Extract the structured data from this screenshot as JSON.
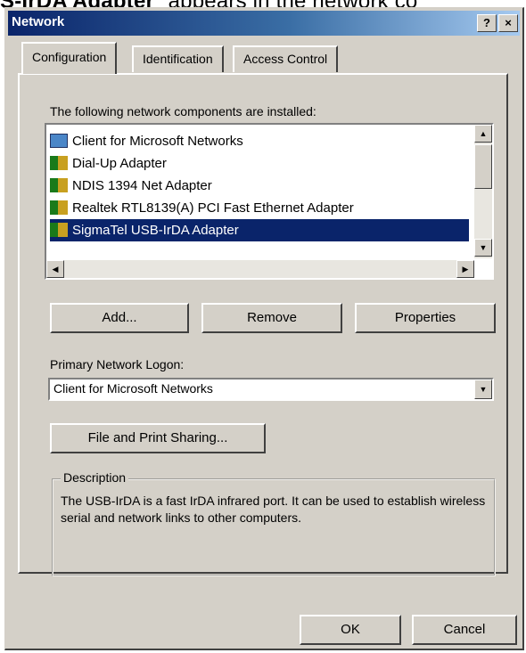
{
  "caption_top": {
    "bold": "S-IrDA Adapter",
    "rest": "\" appears in the network co"
  },
  "window": {
    "title": "Network",
    "help_btn": "?",
    "close_btn": "×"
  },
  "tabs": [
    "Configuration",
    "Identification",
    "Access Control"
  ],
  "components_label": "The following network components are installed:",
  "components": [
    {
      "label": "Client for Microsoft Networks",
      "icon": "network-client-icon",
      "selected": false
    },
    {
      "label": "Dial-Up Adapter",
      "icon": "network-adapter-icon",
      "selected": false
    },
    {
      "label": "NDIS 1394 Net Adapter",
      "icon": "network-adapter-icon",
      "selected": false
    },
    {
      "label": "Realtek RTL8139(A) PCI Fast Ethernet Adapter",
      "icon": "network-adapter-icon",
      "selected": false
    },
    {
      "label": "SigmaTel USB-IrDA Adapter",
      "icon": "network-adapter-icon",
      "selected": true
    }
  ],
  "buttons": {
    "add": "Add...",
    "remove": "Remove",
    "properties": "Properties",
    "file_print": "File and Print Sharing...",
    "ok": "OK",
    "cancel": "Cancel"
  },
  "logon": {
    "label": "Primary Network Logon:",
    "value": "Client for Microsoft Networks"
  },
  "description": {
    "legend": "Description",
    "text": "The USB-IrDA is a fast IrDA infrared port. It can be used to establish wireless serial and network links to other computers."
  },
  "colors": {
    "titlebar": "#0a246a",
    "selection": "#0a246a",
    "face": "#d4d0c8"
  }
}
